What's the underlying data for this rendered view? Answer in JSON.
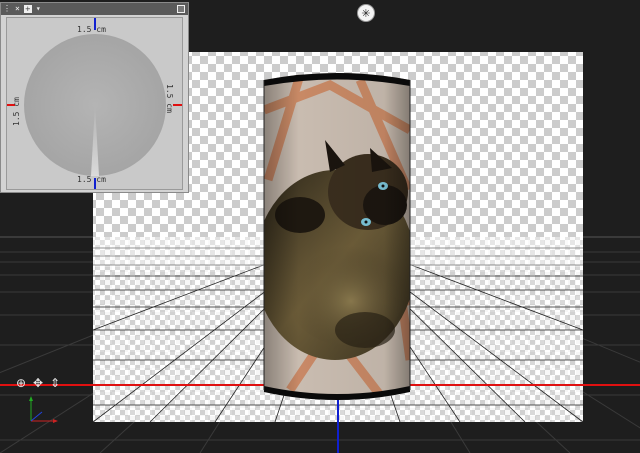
{
  "preview_panel": {
    "titlebar": {
      "menu_glyph": "⋮",
      "close_glyph": "×",
      "add_glyph": "+",
      "dropdown_glyph": "▾"
    },
    "dimension_label": "1.5 cm"
  },
  "viewport": {
    "camera_icon": "camera-view-icon",
    "camera_glyph": "✳",
    "colors": {
      "x_axis": "#e01010",
      "z_axis": "#1020d0",
      "grid_line": "#000000",
      "accent": "#b8a132"
    }
  },
  "gizmo": {
    "tools": [
      {
        "icon": "orbit-icon",
        "glyph": "⊕"
      },
      {
        "icon": "pan-icon",
        "glyph": "✥"
      },
      {
        "icon": "zoom-icon",
        "glyph": "⇕"
      }
    ]
  }
}
